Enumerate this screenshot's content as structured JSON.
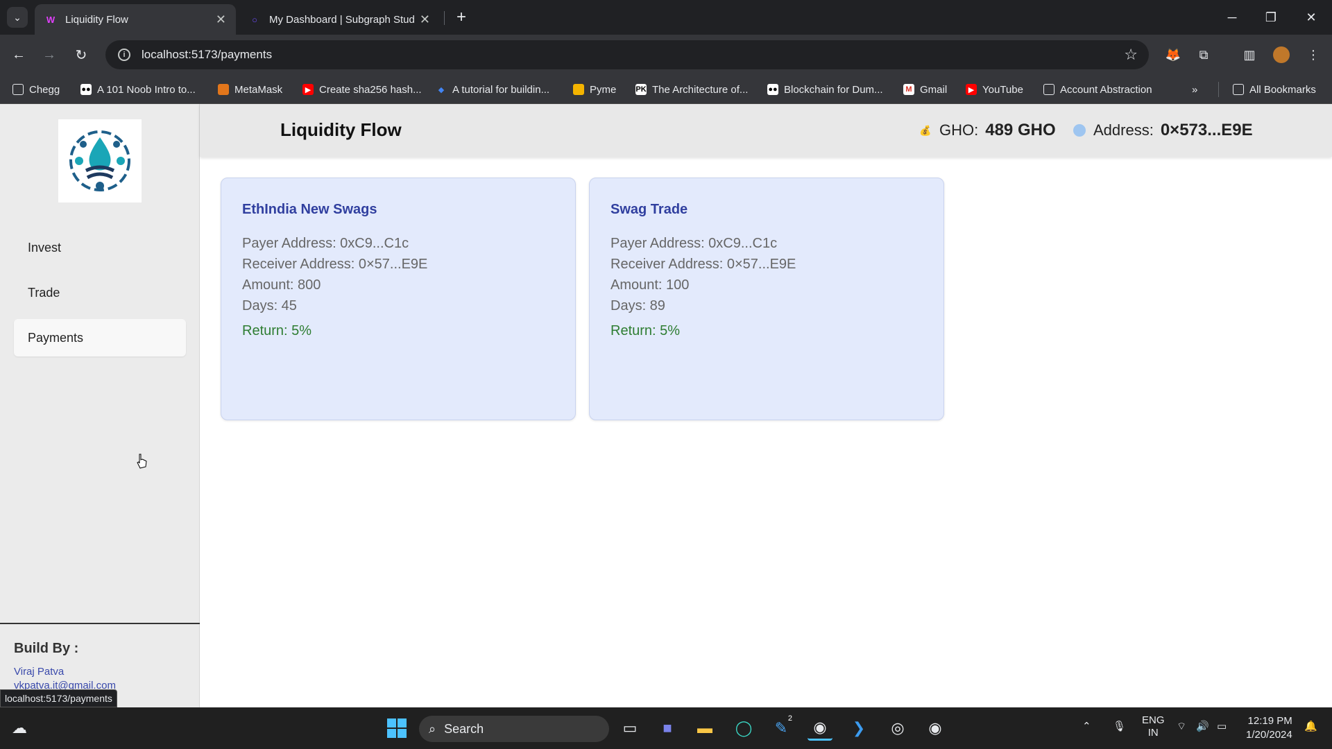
{
  "browser": {
    "tabs": [
      {
        "title": "Liquidity Flow",
        "active": true
      },
      {
        "title": "My Dashboard | Subgraph Stud",
        "active": false
      }
    ],
    "url": "localhost:5173/payments",
    "bookmarks": [
      {
        "label": "Chegg",
        "icon": "folder-icon"
      },
      {
        "label": "A 101 Noob Intro to...",
        "icon": "medium-icon"
      },
      {
        "label": "MetaMask",
        "icon": "metamask-icon"
      },
      {
        "label": "Create sha256 hash...",
        "icon": "youtube-icon"
      },
      {
        "label": "A tutorial for buildin...",
        "icon": "diamond-icon"
      },
      {
        "label": "Pyme",
        "icon": "handshake-icon"
      },
      {
        "label": "The Architecture of...",
        "icon": "pk-icon"
      },
      {
        "label": "Blockchain for Dum...",
        "icon": "medium-icon"
      },
      {
        "label": "Gmail",
        "icon": "gmail-icon"
      },
      {
        "label": "YouTube",
        "icon": "youtube-icon"
      },
      {
        "label": "Account Abstraction",
        "icon": "folder-icon"
      }
    ],
    "all_bookmarks": "All Bookmarks",
    "status_url": "localhost:5173/payments"
  },
  "app": {
    "title": "Liquidity Flow",
    "gho_label": "GHO:",
    "gho_value": "489 GHO",
    "address_label": "Address:",
    "address_value": "0×573...E9E",
    "nav": [
      {
        "label": "Invest"
      },
      {
        "label": "Trade"
      },
      {
        "label": "Payments",
        "active": true
      }
    ],
    "build_by": "Build By :",
    "builder_name": "Viraj Patva",
    "builder_email": "vkpatva.it@gmail.com"
  },
  "payments": [
    {
      "title": "EthIndia New Swags",
      "payer": "Payer Address: 0xC9...C1c",
      "receiver": "Receiver Address: 0×57...E9E",
      "amount": "Amount: 800",
      "days": "Days: 45",
      "return": "Return: 5%"
    },
    {
      "title": "Swag Trade",
      "payer": "Payer Address: 0xC9...C1c",
      "receiver": "Receiver Address: 0×57...E9E",
      "amount": "Amount: 100",
      "days": "Days: 89",
      "return": "Return: 5%"
    }
  ],
  "taskbar": {
    "search": "Search",
    "lang_top": "ENG",
    "lang_bottom": "IN",
    "time": "12:19 PM",
    "date": "1/20/2024",
    "badge": "2"
  },
  "colors": {
    "accent": "#303f9f",
    "card_bg": "#e3eafc",
    "return_green": "#2e7d32"
  }
}
